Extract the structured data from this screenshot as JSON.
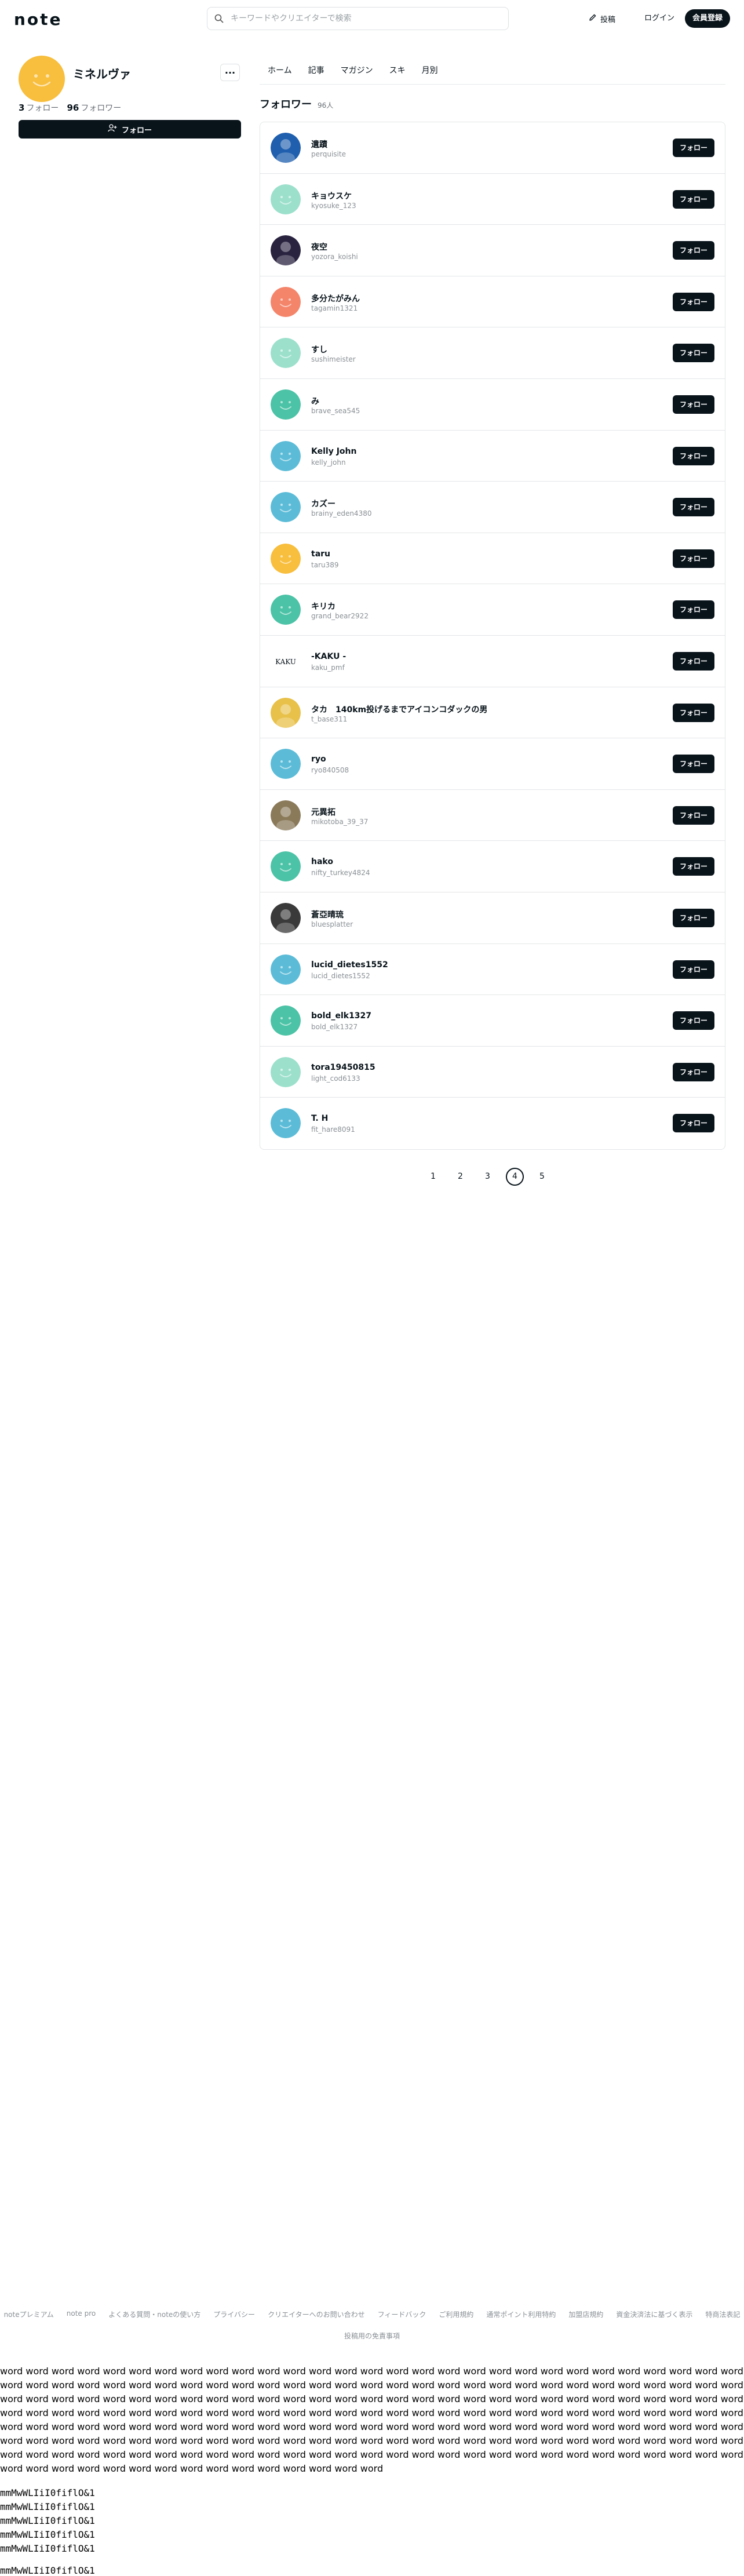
{
  "header": {
    "logo": "note",
    "search_placeholder": "キーワードやクリエイターで検索",
    "post_label": "投稿",
    "login_label": "ログイン",
    "signup_label": "会員登録"
  },
  "profile": {
    "name": "ミネルヴァ",
    "follow_count": "3",
    "follow_label": "フォロー",
    "follower_count": "96",
    "follower_label": "フォロワー",
    "follow_button": "フォロー",
    "more": "···",
    "avatar_color": "#F8BE3D"
  },
  "tabs": [
    "ホーム",
    "記事",
    "マガジン",
    "スキ",
    "月別"
  ],
  "section": {
    "title": "フォロワー",
    "count": "96人"
  },
  "followers": [
    {
      "name": "遺蹟",
      "handle": "perquisite",
      "color": "#1F5FAE",
      "kind": "photo"
    },
    {
      "name": "キョウスケ",
      "handle": "kyosuke_123",
      "color": "#9CE0CC",
      "kind": "default"
    },
    {
      "name": "夜空",
      "handle": "yozora_koishi",
      "color": "#2A2340",
      "kind": "photo"
    },
    {
      "name": "多分たがみん",
      "handle": "tagamin1321",
      "color": "#F4856B",
      "kind": "default"
    },
    {
      "name": "すし",
      "handle": "sushimeister",
      "color": "#9CE0CC",
      "kind": "default"
    },
    {
      "name": "み",
      "handle": "brave_sea545",
      "color": "#4CC3A6",
      "kind": "default"
    },
    {
      "name": "Kelly John",
      "handle": "kelly_john",
      "color": "#5CBCD8",
      "kind": "default"
    },
    {
      "name": "カズー",
      "handle": "brainy_eden4380",
      "color": "#5CBCD8",
      "kind": "default"
    },
    {
      "name": "taru",
      "handle": "taru389",
      "color": "#F8BE3D",
      "kind": "default"
    },
    {
      "name": "キリカ",
      "handle": "grand_bear2922",
      "color": "#4CC3A6",
      "kind": "default"
    },
    {
      "name": "-KAKU -",
      "handle": "kaku_pmf",
      "color": "#FFFFFF",
      "kind": "text"
    },
    {
      "name": "タカ　140km投げるまでアイコンコダックの男",
      "handle": "t_base311",
      "color": "#E8C14A",
      "kind": "photo"
    },
    {
      "name": "ryo",
      "handle": "ryo840508",
      "color": "#5CBCD8",
      "kind": "default"
    },
    {
      "name": "元異拓",
      "handle": "mikotoba_39_37",
      "color": "#8A7A5A",
      "kind": "photo"
    },
    {
      "name": "hako",
      "handle": "nifty_turkey4824",
      "color": "#4CC3A6",
      "kind": "default"
    },
    {
      "name": "蒼亞晴琉",
      "handle": "bluesplatter",
      "color": "#3A3A3A",
      "kind": "photo"
    },
    {
      "name": "lucid_dietes1552",
      "handle": "lucid_dietes1552",
      "color": "#5CBCD8",
      "kind": "default"
    },
    {
      "name": "bold_elk1327",
      "handle": "bold_elk1327",
      "color": "#4CC3A6",
      "kind": "default"
    },
    {
      "name": "tora19450815",
      "handle": "light_cod6133",
      "color": "#9CE0CC",
      "kind": "default"
    },
    {
      "name": "T. H",
      "handle": "fit_hare8091",
      "color": "#5CBCD8",
      "kind": "default"
    }
  ],
  "follow_button_label": "フォロー",
  "kaku_text": "KAKU",
  "pagination": [
    "1",
    "2",
    "3",
    "4",
    "5"
  ],
  "pagination_current": "4",
  "footer": {
    "links": [
      "noteプレミアム",
      "note pro",
      "よくある質問・noteの使い方",
      "プライバシー",
      "クリエイターへのお問い合わせ",
      "フィードバック",
      "ご利用規約",
      "通常ポイント利用特約",
      "加盟店規約",
      "資金決済法に基づく表示",
      "特商法表記"
    ],
    "sub": "投稿用の免責事項"
  },
  "filler_text": "word word word word word word word word word word word word word word word word word word word word word word word word word word word word word word word word word word word word word word word word word word word word word word word word word word word word word word word word word word word word word word word word word word word word word word word word word word word word word word word word word word word word word word word word word word word word word word word word word word word word word word word word word word word word word word word word word word word word word word word word word word word word word word word word word word word word word word word word word word word word word word word word word word word word word word word word word word word word word word word word word word word word word word word word word word word word word word word word word word word word word word word word word word word word word word word word word word word word word word word word word word word word word word word word word word word word word word word word word word",
  "mono_lines": [
    "mmMwWLIiI0fiflO&1",
    "mmMwWLIiI0fiflO&1",
    "mmMwWLIiI0fiflO&1",
    "mmMwWLIiI0fiflO&1",
    "mmMwWLIiI0fiflO&1",
    "mmMwWLIiI0fiflO&1"
  ]
}
